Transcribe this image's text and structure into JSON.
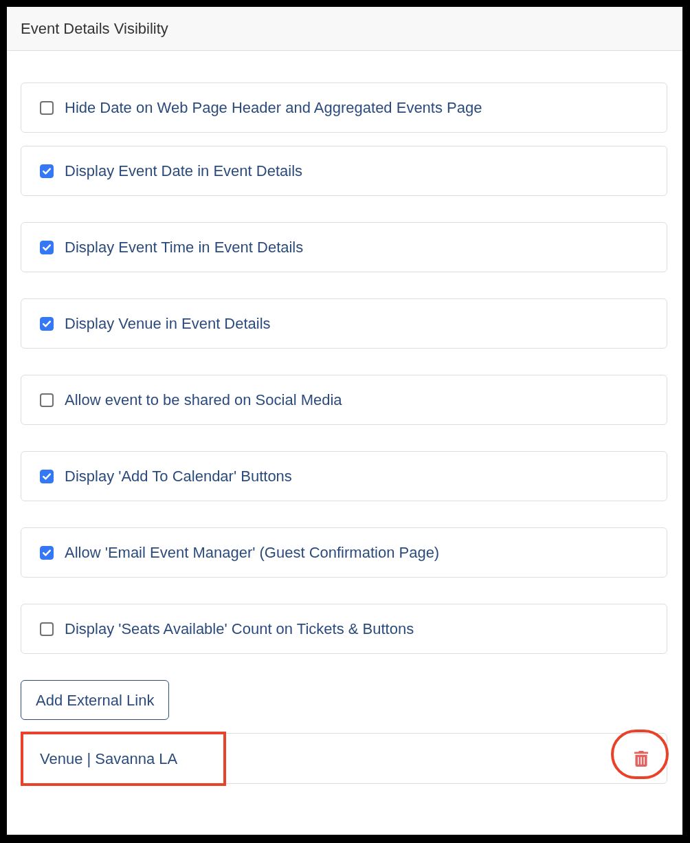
{
  "panel": {
    "title": "Event Details Visibility"
  },
  "options": [
    {
      "label": "Hide Date on Web Page Header and Aggregated Events Page",
      "checked": false
    },
    {
      "label": "Display Event Date in Event Details",
      "checked": true
    },
    {
      "label": "Display Event Time in Event Details",
      "checked": true
    },
    {
      "label": "Display Venue in Event Details",
      "checked": true
    },
    {
      "label": "Allow event to be shared on Social Media",
      "checked": false
    },
    {
      "label": "Display 'Add To Calendar' Buttons",
      "checked": true
    },
    {
      "label": "Allow 'Email Event Manager' (Guest Confirmation Page)",
      "checked": true
    },
    {
      "label": "Display 'Seats Available' Count on Tickets & Buttons",
      "checked": false
    }
  ],
  "add_button": {
    "label": "Add External Link"
  },
  "external_links": [
    {
      "label": "Venue | Savanna LA",
      "label_highlighted": true,
      "delete_highlighted": true
    }
  ]
}
